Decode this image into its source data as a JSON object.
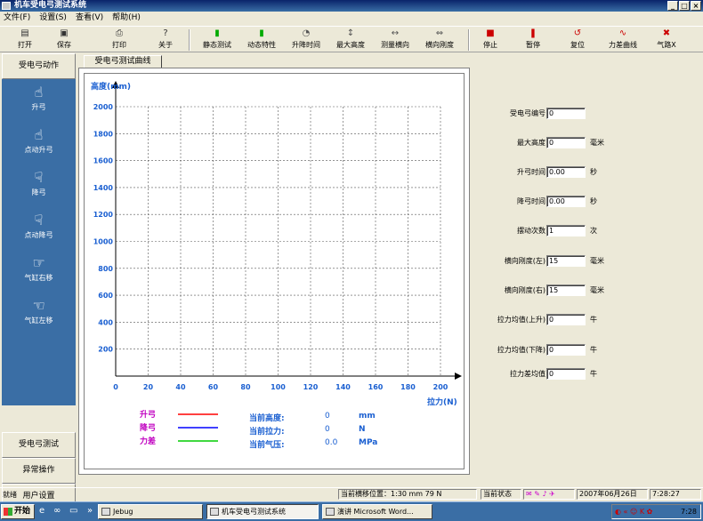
{
  "window": {
    "title": "机车受电弓测试系统",
    "controls": [
      "_",
      "□",
      "×"
    ]
  },
  "menu": [
    "文件(F)",
    "设置(S)",
    "查看(V)",
    "帮助(H)"
  ],
  "toolbar": [
    {
      "label": "打开",
      "icon": "folder-icon"
    },
    {
      "label": "保存",
      "icon": "disk-icon"
    },
    {
      "label": "打印",
      "icon": "printer-icon"
    },
    {
      "label": "关于",
      "icon": "help-icon"
    },
    {
      "label": "静态测试",
      "icon": "test-icon"
    },
    {
      "label": "动态特性",
      "icon": "dynamic-icon"
    },
    {
      "label": "升降时间",
      "icon": "timer-icon"
    },
    {
      "label": "最大高度",
      "icon": "height-icon"
    },
    {
      "label": "测量横向",
      "icon": "lateral-icon"
    },
    {
      "label": "横向刚度",
      "icon": "stiffness-icon"
    },
    {
      "label": "停止",
      "icon": "stop-icon"
    },
    {
      "label": "暂停",
      "icon": "pause-icon"
    },
    {
      "label": "复位",
      "icon": "reset-icon"
    },
    {
      "label": "力差曲线",
      "icon": "curve-icon"
    },
    {
      "label": "气路X",
      "icon": "air-icon"
    }
  ],
  "left_panel": {
    "header": "受电弓动作",
    "items": [
      {
        "label": "升弓",
        "icon": "hand-up-icon",
        "glyph": "☝"
      },
      {
        "label": "点动升弓",
        "icon": "hand-point-up-icon",
        "glyph": "☝"
      },
      {
        "label": "降弓",
        "icon": "hand-down-icon",
        "glyph": "☟"
      },
      {
        "label": "点动降弓",
        "icon": "hand-point-down-icon",
        "glyph": "☟"
      },
      {
        "label": "气缸右移",
        "icon": "hand-right-icon",
        "glyph": "☞"
      },
      {
        "label": "气缸左移",
        "icon": "hand-left-icon",
        "glyph": "☜"
      }
    ],
    "buttons": [
      "受电弓测试",
      "异常操作",
      "用户设置"
    ]
  },
  "tab": {
    "label": "受电弓测试曲线"
  },
  "chart_data": {
    "type": "line",
    "ylabel": "高度(mm)",
    "xlabel": "拉力(N)",
    "xlim": [
      0,
      200
    ],
    "ylim": [
      0,
      2000
    ],
    "xticks": [
      0,
      20,
      40,
      60,
      80,
      100,
      120,
      140,
      160,
      180,
      200
    ],
    "yticks": [
      200,
      400,
      600,
      800,
      1000,
      1200,
      1400,
      1600,
      1800,
      2000
    ],
    "grid": true,
    "series": [
      {
        "name": "升弓",
        "color": "#ff0000",
        "values": []
      },
      {
        "name": "降弓",
        "color": "#0000ff",
        "values": []
      },
      {
        "name": "力差",
        "color": "#00cc00",
        "values": []
      }
    ]
  },
  "readouts": [
    {
      "label": "当前高度:",
      "value": "0",
      "unit": "mm"
    },
    {
      "label": "当前拉力:",
      "value": "0",
      "unit": "N"
    },
    {
      "label": "当前气压:",
      "value": "0.0",
      "unit": "MPa"
    }
  ],
  "params": [
    {
      "label": "受电弓编号",
      "value": "0",
      "unit": ""
    },
    {
      "label": "最大高度",
      "value": "0",
      "unit": "毫米"
    },
    {
      "label": "升弓时间",
      "value": "0.00",
      "unit": "秒"
    },
    {
      "label": "降弓时间",
      "value": "0.00",
      "unit": "秒"
    },
    {
      "label": "摆动次数",
      "value": "1",
      "unit": "次"
    },
    {
      "label": "横向刚度(左)",
      "value": "15",
      "unit": "毫米"
    },
    {
      "label": "横向刚度(右)",
      "value": "15",
      "unit": "毫米"
    },
    {
      "label": "拉力均值(上升)",
      "value": "0",
      "unit": "牛"
    },
    {
      "label": "拉力均值(下降)",
      "value": "0",
      "unit": "牛"
    },
    {
      "label": "拉力差均值",
      "value": "0",
      "unit": "牛"
    }
  ],
  "status": {
    "ready": "就绪",
    "position": "当前横移位置：1:30 mm  79 N",
    "state": "当前状态",
    "date": "2007年06月26日",
    "time": "7:28:27"
  },
  "taskbar": {
    "start": "开始",
    "tasks": [
      "Jebug",
      "机车受电弓测试系统",
      "演讲 Microsoft Word..."
    ],
    "clock": "7:28"
  }
}
